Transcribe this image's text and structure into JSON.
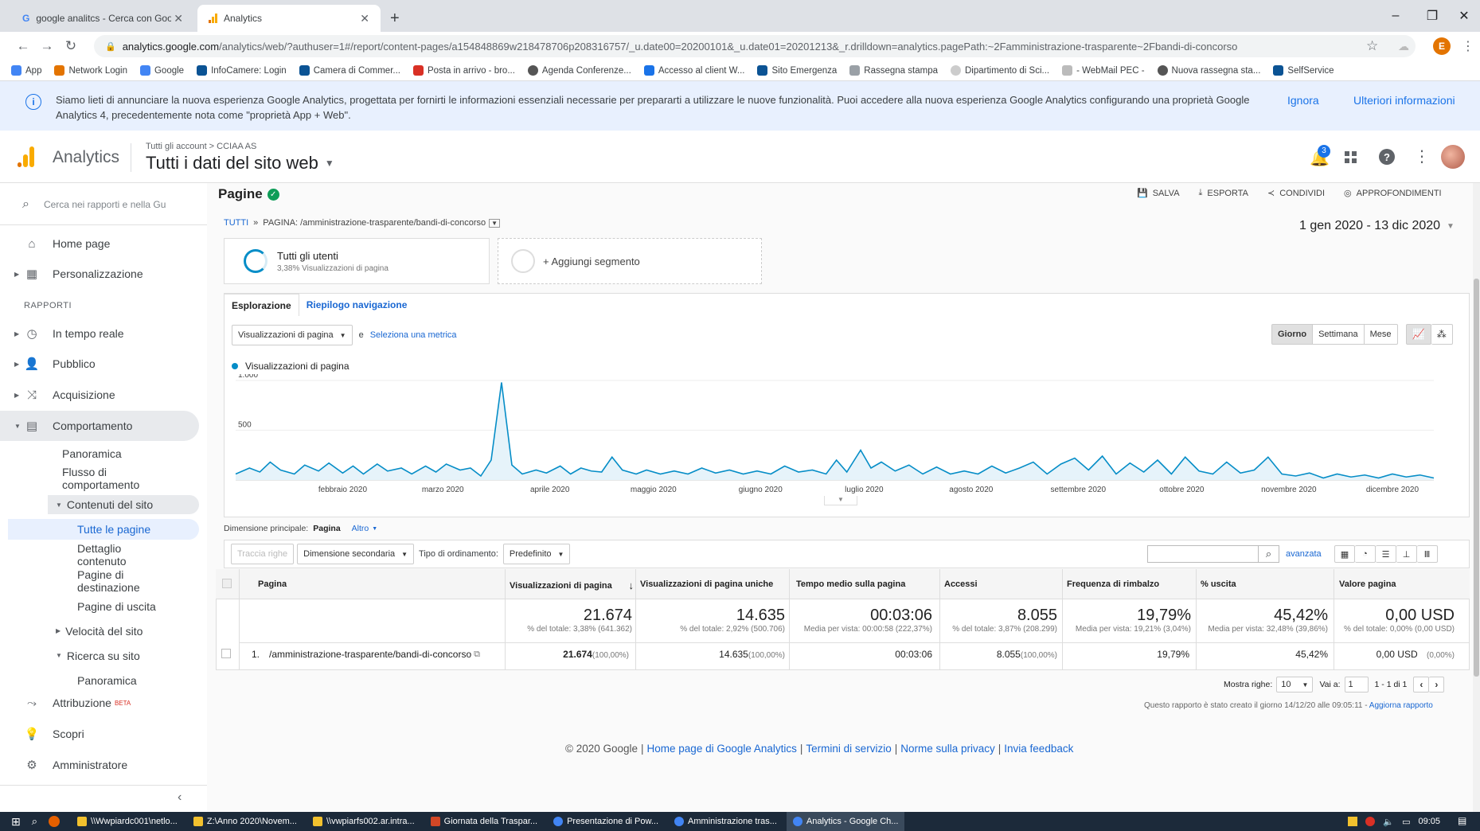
{
  "browser": {
    "tabs": [
      {
        "title": "google analitcs - Cerca con Goo",
        "active": false
      },
      {
        "title": "Analytics",
        "active": true
      }
    ],
    "url_host": "analytics.google.com",
    "url_path": "/analytics/web/?authuser=1#/report/content-pages/a154848869w218478706p208316757/_u.date00=20200101&_u.date01=20201213&_r.drilldown=analytics.pagePath:~2Famministrazione-trasparente~2Fbandi-di-concorso",
    "bookmarks": [
      "App",
      "Network Login",
      "Google",
      "InfoCamere: Login",
      "Camera di Commer...",
      "Posta in arrivo - bro...",
      "Agenda Conferenze...",
      "Accesso al client W...",
      "Sito Emergenza",
      "Rassegna stampa",
      "Dipartimento di Sci...",
      "- WebMail PEC -",
      "Nuova rassegna sta...",
      "SelfService"
    ],
    "profile_initial": "E"
  },
  "banner": {
    "text": "Siamo lieti di annunciare la nuova esperienza Google Analytics, progettata per fornirti le informazioni essenziali necessarie per prepararti a utilizzare le nuove funzionalità. Puoi accedere alla nuova esperienza Google Analytics configurando una proprietà Google Analytics 4, precedentemente nota come \"proprietà App + Web\".",
    "ignore": "Ignora",
    "more": "Ulteriori informazioni"
  },
  "header": {
    "app_name": "Analytics",
    "breadcrumb": "Tutti gli account > CCIAA AS",
    "property": "Tutti i dati del sito web",
    "notif_count": "3"
  },
  "sidebar": {
    "search_placeholder": "Cerca nei rapporti e nella Gu",
    "home": "Home page",
    "custom": "Personalizzazione",
    "section": "RAPPORTI",
    "realtime": "In tempo reale",
    "audience": "Pubblico",
    "acquisition": "Acquisizione",
    "behavior": "Comportamento",
    "overview": "Panoramica",
    "flow": "Flusso di comportamento",
    "site_content": "Contenuti del sito",
    "all_pages": "Tutte le pagine",
    "drilldown": "Dettaglio contenuto",
    "landing": "Pagine di destinazione",
    "exit": "Pagine di uscita",
    "speed": "Velocità del sito",
    "search": "Ricerca su sito",
    "search_overview": "Panoramica",
    "attribution": "Attribuzione",
    "beta": "BETA",
    "discover": "Scopri",
    "admin": "Amministratore"
  },
  "report": {
    "title": "Pagine",
    "actions": {
      "save": "SALVA",
      "export": "ESPORTA",
      "share": "CONDIVIDI",
      "insights": "APPROFONDIMENTI"
    },
    "crumb_all": "TUTTI",
    "crumb_page": "PAGINA: /amministrazione-trasparente/bandi-di-concorso",
    "date_range": "1 gen 2020 - 13 dic 2020",
    "segment_name": "Tutti gli utenti",
    "segment_sub": "3,38% Visualizzazioni di pagina",
    "add_segment": "+ Aggiungi segmento",
    "tab_explore": "Esplorazione",
    "tab_nav": "Riepilogo navigazione",
    "metric_select": "Visualizzazioni di pagina",
    "and": "e",
    "select_metric": "Seleziona una metrica",
    "period": [
      "Giorno",
      "Settimana",
      "Mese"
    ],
    "legend": "Visualizzazioni di pagina",
    "primary_dim_label": "Dimensione principale:",
    "primary_dim": "Pagina",
    "other": "Altro",
    "plot_rows": "Traccia righe",
    "secondary_dim": "Dimensione secondaria",
    "sort_type_label": "Tipo di ordinamento:",
    "sort_type": "Predefinito",
    "advanced": "avanzata",
    "columns": [
      "Pagina",
      "Visualizzazioni di pagina",
      "Visualizzazioni di pagina uniche",
      "Tempo medio sulla pagina",
      "Accessi",
      "Frequenza di rimbalzo",
      "% uscita",
      "Valore pagina"
    ],
    "totals": [
      {
        "value": "21.674",
        "sub": "% del totale: 3,38% (641.362)"
      },
      {
        "value": "14.635",
        "sub": "% del totale: 2,92% (500.706)"
      },
      {
        "value": "00:03:06",
        "sub": "Media per vista: 00:00:58 (222,37%)"
      },
      {
        "value": "8.055",
        "sub": "% del totale: 3,87% (208.299)"
      },
      {
        "value": "19,79%",
        "sub": "Media per vista: 19,21% (3,04%)"
      },
      {
        "value": "45,42%",
        "sub": "Media per vista: 32,48% (39,86%)"
      },
      {
        "value": "0,00 USD",
        "sub": "% del totale: 0,00% (0,00 USD)"
      }
    ],
    "row": {
      "index": "1.",
      "page": "/amministrazione-trasparente/bandi-di-concorso",
      "pv": "21.674",
      "pv_pct": "(100,00%)",
      "upv": "14.635",
      "upv_pct": "(100,00%)",
      "time": "00:03:06",
      "entrances": "8.055",
      "ent_pct": "(100,00%)",
      "bounce": "19,79%",
      "exit": "45,42%",
      "value": "0,00 USD",
      "value_pct": "(0,00%)"
    },
    "show_rows_label": "Mostra righe:",
    "show_rows": "10",
    "goto_label": "Vai a:",
    "goto": "1",
    "range": "1 - 1 di 1",
    "created_note": "Questo rapporto è stato creato il giorno 14/12/20 alle 09:05:11 -",
    "refresh": "Aggiorna rapporto"
  },
  "footer": {
    "copyright": "© 2020 Google",
    "links": [
      "Home page di Google Analytics",
      "Termini di servizio",
      "Norme sulla privacy",
      "Invia feedback"
    ]
  },
  "taskbar": {
    "items": [
      "\\\\Wwpiardc001\\netlo...",
      "Z:\\Anno 2020\\Novem...",
      "\\\\vwpiarfs002.ar.intra...",
      "Giornata della Traspar...",
      "Presentazione di Pow...",
      "Amministrazione tras...",
      "Analytics - Google Ch..."
    ],
    "time": "09:05"
  },
  "chart_data": {
    "type": "line",
    "title": "",
    "series": [
      {
        "name": "Visualizzazioni di pagina",
        "color": "#058dc7"
      }
    ],
    "x_tick_labels": [
      "febbraio 2020",
      "marzo 2020",
      "aprile 2020",
      "maggio 2020",
      "giugno 2020",
      "luglio 2020",
      "agosto 2020",
      "settembre 2020",
      "ottobre 2020",
      "novembre 2020",
      "dicembre 2020"
    ],
    "y_tick_labels": [
      "1.000",
      "500"
    ],
    "ylim": [
      0,
      1000
    ],
    "x_range_days": [
      1,
      348
    ],
    "points": [
      [
        1,
        60
      ],
      [
        5,
        120
      ],
      [
        8,
        80
      ],
      [
        11,
        180
      ],
      [
        14,
        100
      ],
      [
        18,
        60
      ],
      [
        21,
        150
      ],
      [
        25,
        90
      ],
      [
        28,
        170
      ],
      [
        32,
        70
      ],
      [
        35,
        140
      ],
      [
        38,
        60
      ],
      [
        42,
        160
      ],
      [
        45,
        90
      ],
      [
        49,
        120
      ],
      [
        52,
        60
      ],
      [
        56,
        140
      ],
      [
        59,
        80
      ],
      [
        62,
        160
      ],
      [
        66,
        100
      ],
      [
        69,
        120
      ],
      [
        72,
        40
      ],
      [
        75,
        200
      ],
      [
        78,
        980
      ],
      [
        81,
        150
      ],
      [
        84,
        60
      ],
      [
        88,
        100
      ],
      [
        91,
        70
      ],
      [
        95,
        140
      ],
      [
        98,
        60
      ],
      [
        101,
        120
      ],
      [
        104,
        90
      ],
      [
        107,
        80
      ],
      [
        110,
        230
      ],
      [
        113,
        100
      ],
      [
        117,
        60
      ],
      [
        120,
        100
      ],
      [
        124,
        60
      ],
      [
        128,
        90
      ],
      [
        132,
        60
      ],
      [
        136,
        120
      ],
      [
        140,
        70
      ],
      [
        144,
        100
      ],
      [
        148,
        60
      ],
      [
        152,
        90
      ],
      [
        156,
        60
      ],
      [
        160,
        140
      ],
      [
        164,
        80
      ],
      [
        168,
        100
      ],
      [
        172,
        60
      ],
      [
        175,
        200
      ],
      [
        178,
        80
      ],
      [
        182,
        300
      ],
      [
        185,
        120
      ],
      [
        188,
        180
      ],
      [
        192,
        90
      ],
      [
        196,
        150
      ],
      [
        200,
        60
      ],
      [
        204,
        130
      ],
      [
        208,
        60
      ],
      [
        212,
        90
      ],
      [
        216,
        60
      ],
      [
        220,
        140
      ],
      [
        224,
        70
      ],
      [
        228,
        120
      ],
      [
        232,
        180
      ],
      [
        236,
        60
      ],
      [
        240,
        160
      ],
      [
        244,
        220
      ],
      [
        248,
        100
      ],
      [
        252,
        240
      ],
      [
        256,
        60
      ],
      [
        260,
        170
      ],
      [
        264,
        80
      ],
      [
        268,
        200
      ],
      [
        272,
        60
      ],
      [
        276,
        230
      ],
      [
        280,
        90
      ],
      [
        284,
        60
      ],
      [
        288,
        180
      ],
      [
        292,
        70
      ],
      [
        296,
        100
      ],
      [
        300,
        230
      ],
      [
        304,
        60
      ],
      [
        308,
        40
      ],
      [
        312,
        70
      ],
      [
        316,
        20
      ],
      [
        320,
        60
      ],
      [
        324,
        30
      ],
      [
        328,
        50
      ],
      [
        332,
        20
      ],
      [
        336,
        60
      ],
      [
        340,
        30
      ],
      [
        344,
        50
      ],
      [
        348,
        20
      ]
    ]
  }
}
